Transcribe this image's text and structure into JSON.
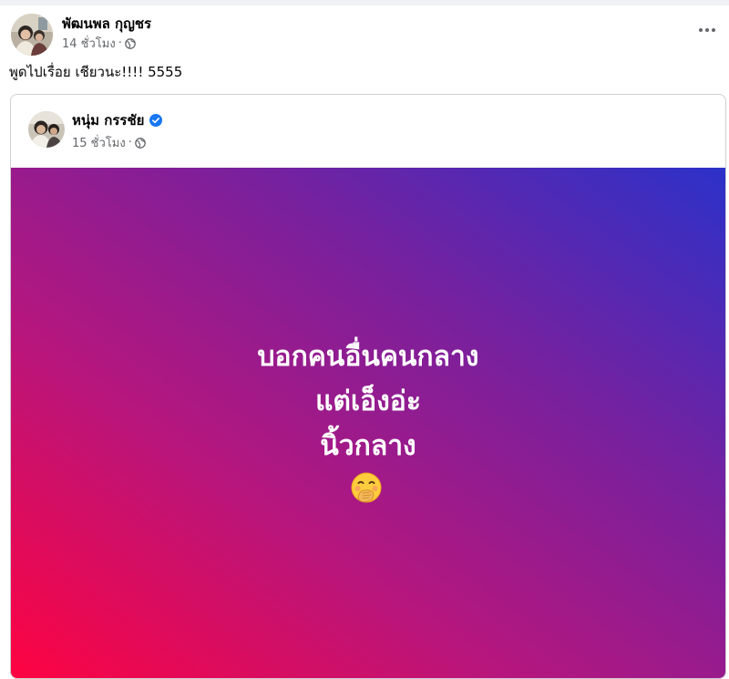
{
  "post": {
    "author": "พัฒนพล กุญชร",
    "time": "14 ชั่วโมง",
    "separator": "·",
    "privacy_icon": "globe-icon",
    "more_icon": "more-options-icon",
    "text": "พูดไปเรื่อย เชียวนะ!!!! 5555"
  },
  "shared": {
    "author": "หนุ่ม กรรชัย",
    "verified_icon": "verified-badge-icon",
    "time": "15 ชั่วโมง",
    "separator": "·",
    "privacy_icon": "globe-icon",
    "lines": [
      "บอกคนอื่นคนกลาง",
      "แต่เอ็งอ่ะ",
      "นิ้วกลาง"
    ],
    "emoji_icon": "face-with-hand-over-mouth-emoji"
  },
  "colors": {
    "gradient_bottom_left": "#fe0341",
    "gradient_top_right": "#2c31c9",
    "verified_blue": "#1877f2",
    "meta_gray": "#65676b"
  }
}
